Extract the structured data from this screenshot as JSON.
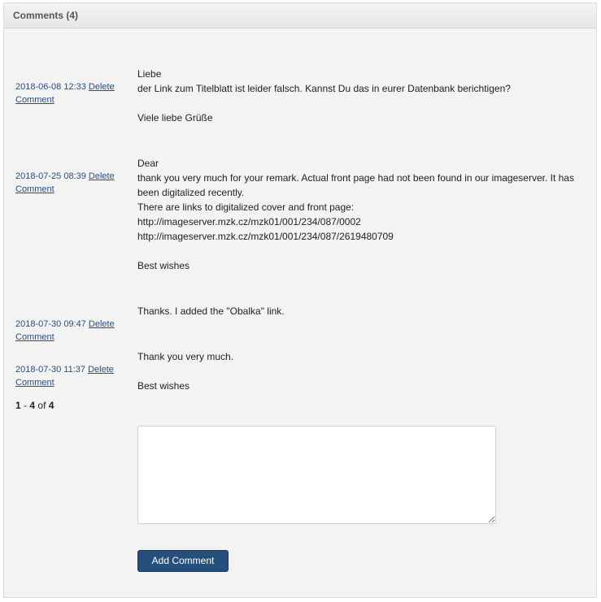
{
  "header": {
    "title": "Comments (4)"
  },
  "comments": [
    {
      "timestamp": "2018-06-08 12:33",
      "delete_word1": "Delete",
      "delete_word2": "Comment",
      "lines": [
        "Liebe",
        "der Link zum Titelblatt ist leider falsch. Kannst Du das in eurer Datenbank berichtigen?",
        "",
        "Viele liebe Grüße"
      ]
    },
    {
      "timestamp": "2018-07-25 08:39",
      "delete_word1": "Delete",
      "delete_word2": "Comment",
      "lines": [
        "Dear",
        "thank you very much for your remark. Actual front page had not been found in our imageserver. It has",
        "been digitalized recently.",
        "There are links to digitalized cover and front page:",
        "http://imageserver.mzk.cz/mzk01/001/234/087/0002",
        "http://imageserver.mzk.cz/mzk01/001/234/087/2619480709",
        "",
        "Best wishes"
      ]
    },
    {
      "timestamp": "2018-07-30 09:47",
      "delete_word1": "Delete",
      "delete_word2": "Comment",
      "lines": [
        "Thanks. I added the \"Obalka\" link."
      ]
    },
    {
      "timestamp": "2018-07-30 11:37",
      "delete_word1": "Delete",
      "delete_word2": "Comment",
      "lines": [
        "Thank you very much.",
        "",
        "Best wishes"
      ]
    }
  ],
  "pager": {
    "start": "1",
    "sep": "-",
    "end": "4",
    "of": "of",
    "total": "4"
  },
  "form": {
    "textarea_value": "",
    "button_label": "Add Comment"
  }
}
